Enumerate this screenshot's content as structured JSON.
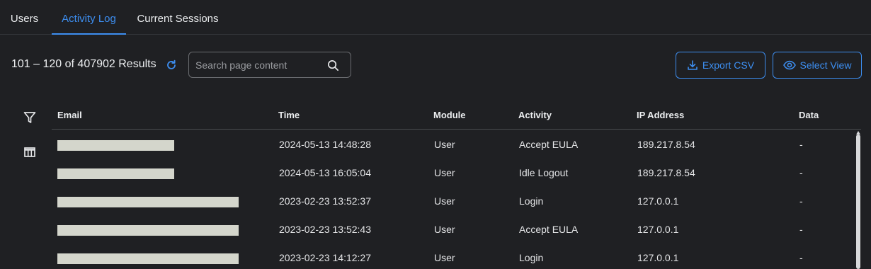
{
  "tabs": [
    {
      "label": "Users",
      "active": false
    },
    {
      "label": "Activity Log",
      "active": true
    },
    {
      "label": "Current Sessions",
      "active": false
    }
  ],
  "toolbar": {
    "results_text": "101 – 120 of 407902 Results",
    "search_placeholder": "Search page content",
    "export_label": "Export CSV",
    "select_view_label": "Select View"
  },
  "table": {
    "columns": [
      "Email",
      "Time",
      "Module",
      "Activity",
      "IP Address",
      "Data"
    ],
    "rows": [
      {
        "email": "",
        "time": "2024-05-13 14:48:28",
        "module": "User",
        "activity": "Accept EULA",
        "ip": "189.217.8.54",
        "data": "-"
      },
      {
        "email": "",
        "time": "2024-05-13 16:05:04",
        "module": "User",
        "activity": "Idle Logout",
        "ip": "189.217.8.54",
        "data": "-"
      },
      {
        "email": "",
        "time": "2023-02-23 13:52:37",
        "module": "User",
        "activity": "Login",
        "ip": "127.0.0.1",
        "data": "-"
      },
      {
        "email": "",
        "time": "2023-02-23 13:52:43",
        "module": "User",
        "activity": "Accept EULA",
        "ip": "127.0.0.1",
        "data": "-"
      },
      {
        "email": "",
        "time": "2023-02-23 14:12:27",
        "module": "User",
        "activity": "Login",
        "ip": "127.0.0.1",
        "data": "-"
      }
    ]
  },
  "icons": {
    "refresh": "refresh-icon",
    "search": "search-icon",
    "export": "download-icon",
    "select_view": "eye-icon",
    "filter": "filter-icon",
    "columns": "columns-icon"
  },
  "colors": {
    "accent": "#3d8ef0",
    "background": "#1f2023",
    "redaction": "#d4d6cc"
  }
}
